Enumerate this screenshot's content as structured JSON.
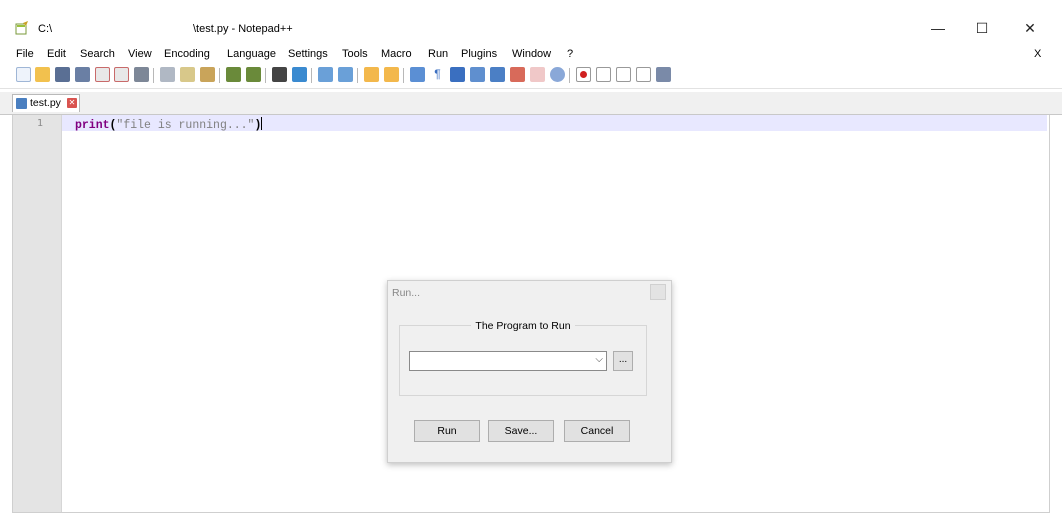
{
  "window": {
    "title_path": "C:\\",
    "title_file": "\\test.py - Notepad++",
    "minimize_glyph": "—",
    "maximize_glyph": "☐",
    "close_glyph": "✕"
  },
  "menu": {
    "items": [
      "File",
      "Edit",
      "Search",
      "View",
      "Encoding",
      "Language",
      "Settings",
      "Tools",
      "Macro",
      "Run",
      "Plugins",
      "Window",
      "?"
    ],
    "close_x": "X"
  },
  "toolbar": {
    "icons": [
      "new-file-icon",
      "open-file-icon",
      "save-icon",
      "save-all-icon",
      "close-icon",
      "close-all-icon",
      "print-icon",
      "cut-icon",
      "copy-icon",
      "paste-icon",
      "undo-icon",
      "redo-icon",
      "find-icon",
      "replace-icon",
      "zoom-in-icon",
      "zoom-out-icon",
      "sync-vertical-icon",
      "sync-horizontal-icon",
      "word-wrap-icon",
      "show-all-chars-icon",
      "indent-guide-icon",
      "language-icon",
      "doc-map-icon",
      "function-list-icon",
      "folder-workspace-icon",
      "monitoring-icon",
      "record-macro-icon",
      "stop-record-icon",
      "play-macro-icon",
      "run-macro-multiple-icon",
      "save-macro-icon"
    ]
  },
  "tabs": [
    {
      "label": "test.py",
      "close": "✕"
    }
  ],
  "editor": {
    "line_number": "1",
    "code": {
      "keyword": "print",
      "open_paren": "(",
      "string": "\"file is running...\"",
      "close_paren": ")"
    }
  },
  "run_dialog": {
    "title": "Run...",
    "group_label": "The Program to Run",
    "program_value": "",
    "combo_arrow": "⌵",
    "browse_label": "...",
    "run_label": "Run",
    "save_label": "Save...",
    "cancel_label": "Cancel"
  },
  "colors": {
    "current_line": "#e8e8ff",
    "keyword": "#800080",
    "string": "#808080",
    "gutter": "#e4e4e4"
  }
}
